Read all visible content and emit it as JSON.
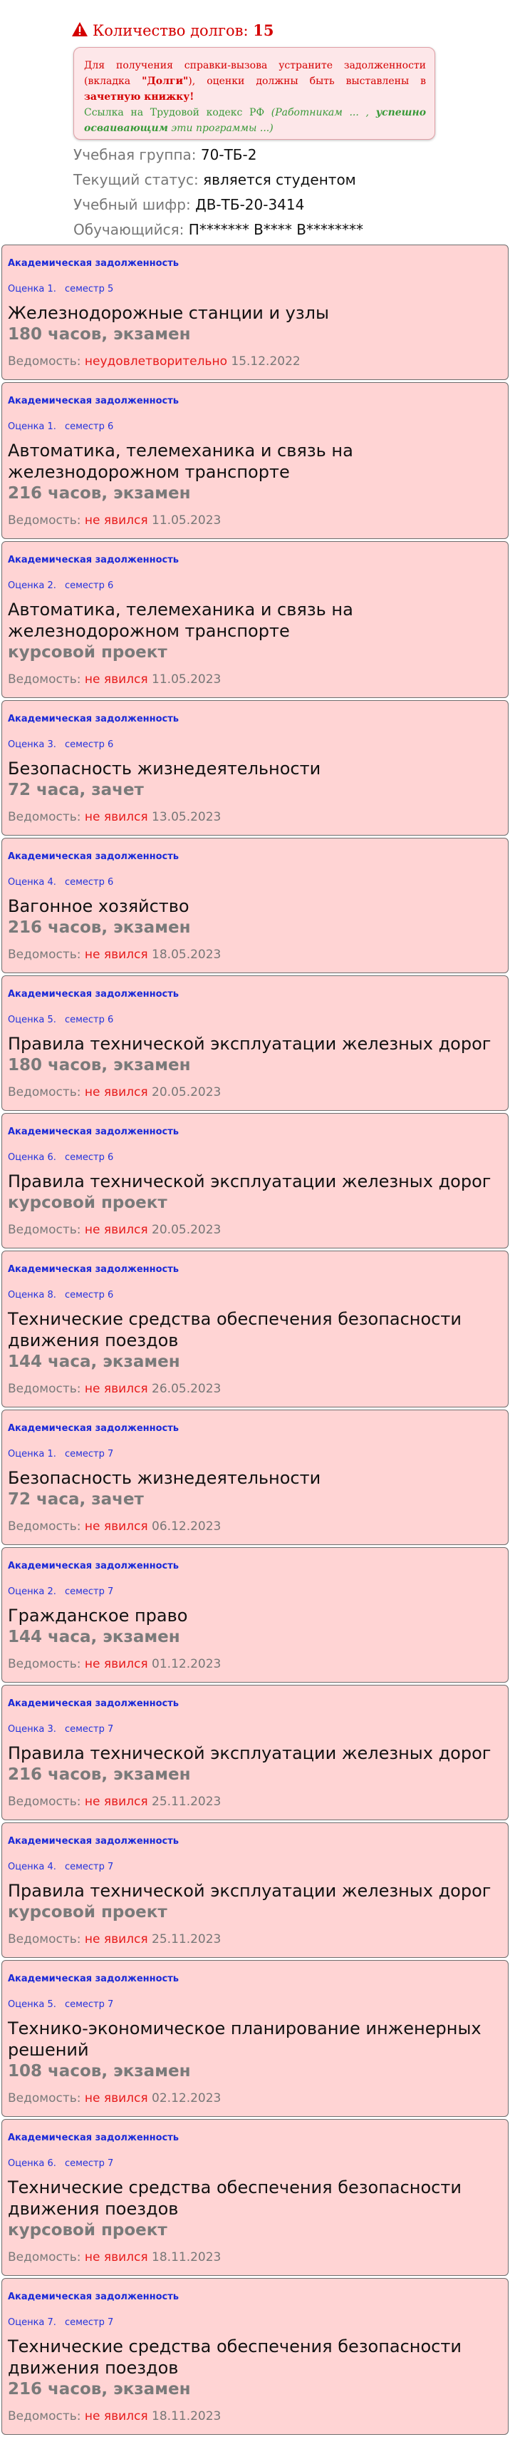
{
  "debts": {
    "label": "Количество долгов:",
    "count": "15"
  },
  "notice": {
    "part1": "Для получения справки-вызова устраните задолженности (вкладка ",
    "tab_name": "\"Долги\"",
    "part2": "), оценки должны быть выставлены в ",
    "record_book": "зачетную книжку!",
    "link_text": "Ссылка на Трудовой кодекс РФ",
    "quote_open": "(Работникам ... ,",
    "quote_bold": "успешно осваивающим",
    "quote_close": "эти программы ...)"
  },
  "student": {
    "group_label": "Учебная группа:",
    "group_value": "70-ТБ-2",
    "status_label": "Текущий статус:",
    "status_value": "является студентом",
    "code_label": "Учебный шифр:",
    "code_value": "ДВ-ТБ-20-3414",
    "name_label": "Обучающийся:",
    "name_value": "П******* В**** В********"
  },
  "debt_list": [
    {
      "kind": "Академическая задолженность",
      "grade": "Оценка 1.",
      "semester": "семестр 5",
      "title": "Железнодорожные станции и узлы",
      "sub": "180 часов, экзамен",
      "sheet_label": "Ведомость:",
      "status": "неудовлетворительно",
      "date": "15.12.2022"
    },
    {
      "kind": "Академическая задолженность",
      "grade": "Оценка 1.",
      "semester": "семестр 6",
      "title": "Автоматика, телемеханика и связь на железнодорожном транспорте",
      "sub": "216 часов, экзамен",
      "sheet_label": "Ведомость:",
      "status": "не явился",
      "date": "11.05.2023"
    },
    {
      "kind": "Академическая задолженность",
      "grade": "Оценка 2.",
      "semester": "семестр 6",
      "title": "Автоматика, телемеханика и связь на железнодорожном транспорте",
      "sub": "курсовой проект",
      "sheet_label": "Ведомость:",
      "status": "не явился",
      "date": "11.05.2023"
    },
    {
      "kind": "Академическая задолженность",
      "grade": "Оценка 3.",
      "semester": "семестр 6",
      "title": "Безопасность жизнедеятельности",
      "sub": "72 часа, зачет",
      "sheet_label": "Ведомость:",
      "status": "не явился",
      "date": "13.05.2023"
    },
    {
      "kind": "Академическая задолженность",
      "grade": "Оценка 4.",
      "semester": "семестр 6",
      "title": "Вагонное хозяйство",
      "sub": "216 часов, экзамен",
      "sheet_label": "Ведомость:",
      "status": "не явился",
      "date": "18.05.2023"
    },
    {
      "kind": "Академическая задолженность",
      "grade": "Оценка 5.",
      "semester": "семестр 6",
      "title": "Правила технической эксплуатации железных дорог",
      "sub": "180 часов, экзамен",
      "sheet_label": "Ведомость:",
      "status": "не явился",
      "date": "20.05.2023"
    },
    {
      "kind": "Академическая задолженность",
      "grade": "Оценка 6.",
      "semester": "семестр 6",
      "title": "Правила технической эксплуатации железных дорог",
      "sub": "курсовой проект",
      "sheet_label": "Ведомость:",
      "status": "не явился",
      "date": "20.05.2023"
    },
    {
      "kind": "Академическая задолженность",
      "grade": "Оценка 8.",
      "semester": "семестр 6",
      "title": "Технические средства обеспечения безопасности движения поездов",
      "sub": "144 часа, экзамен",
      "sheet_label": "Ведомость:",
      "status": "не явился",
      "date": "26.05.2023"
    },
    {
      "kind": "Академическая задолженность",
      "grade": "Оценка 1.",
      "semester": "семестр 7",
      "title": "Безопасность жизнедеятельности",
      "sub": "72 часа, зачет",
      "sheet_label": "Ведомость:",
      "status": "не явился",
      "date": "06.12.2023"
    },
    {
      "kind": "Академическая задолженность",
      "grade": "Оценка 2.",
      "semester": "семестр 7",
      "title": "Гражданское право",
      "sub": "144 часа, экзамен",
      "sheet_label": "Ведомость:",
      "status": "не явился",
      "date": "01.12.2023"
    },
    {
      "kind": "Академическая задолженность",
      "grade": "Оценка 3.",
      "semester": "семестр 7",
      "title": "Правила технической эксплуатации железных дорог",
      "sub": "216 часов, экзамен",
      "sheet_label": "Ведомость:",
      "status": "не явился",
      "date": "25.11.2023"
    },
    {
      "kind": "Академическая задолженность",
      "grade": "Оценка 4.",
      "semester": "семестр 7",
      "title": "Правила технической эксплуатации железных дорог",
      "sub": "курсовой проект",
      "sheet_label": "Ведомость:",
      "status": "не явился",
      "date": "25.11.2023"
    },
    {
      "kind": "Академическая задолженность",
      "grade": "Оценка 5.",
      "semester": "семестр 7",
      "title": "Технико-экономическое планирование инженерных решений",
      "sub": "108 часов, экзамен",
      "sheet_label": "Ведомость:",
      "status": "не явился",
      "date": "02.12.2023"
    },
    {
      "kind": "Академическая задолженность",
      "grade": "Оценка 6.",
      "semester": "семестр 7",
      "title": "Технические средства обеспечения безопасности движения поездов",
      "sub": "курсовой проект",
      "sheet_label": "Ведомость:",
      "status": "не явился",
      "date": "18.11.2023"
    },
    {
      "kind": "Академическая задолженность",
      "grade": "Оценка 7.",
      "semester": "семестр 7",
      "title": "Технические средства обеспечения безопасности движения поездов",
      "sub": "216 часов, экзамен",
      "sheet_label": "Ведомость:",
      "status": "не явился",
      "date": "18.11.2023"
    }
  ],
  "colors": {
    "warning_red": "#d40000",
    "card_bg": "#ffd4d4",
    "status_red": "#e61b1b",
    "label_blue": "#1a2ad8",
    "link_green": "#3a9a3a"
  }
}
